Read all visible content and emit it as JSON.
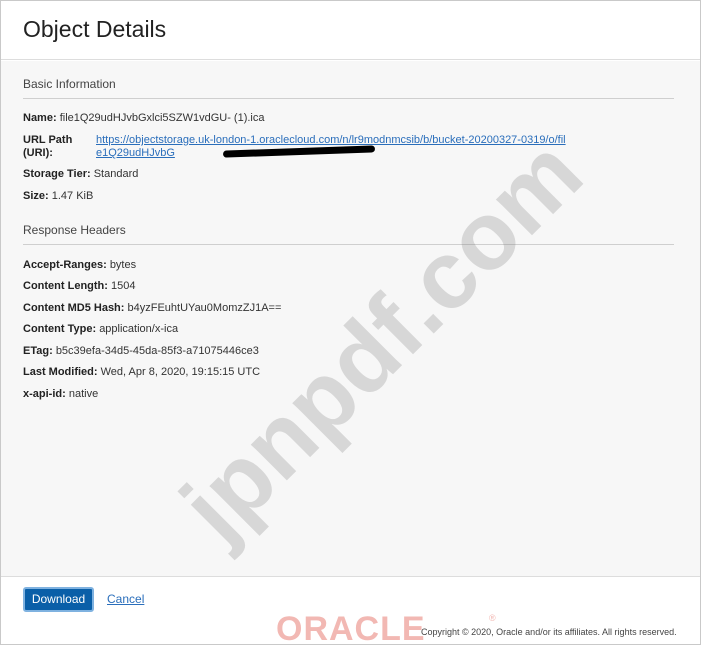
{
  "dialog": {
    "title": "Object Details"
  },
  "basic_info": {
    "heading": "Basic Information",
    "name_label": "Name:",
    "name_value": "file1Q29udHJvbGxlci5SZW1vdGU- (1).ica",
    "url_label": "URL Path (URI):",
    "url_value": "https://objectstorage.uk-london-1.oraclecloud.com/n/lr9modnmcsib/b/bucket-20200327-0319/o/file1Q29udHJvbGxlci5SZW1vdGU-%20(1).ica",
    "url_display": "https://objectstorage.uk-london-1.oraclecloud.com/n/lr9modnmcsib/b/bucket-20200327-0319/o/file1Q29udHJvbG",
    "tier_label": "Storage Tier:",
    "tier_value": "Standard",
    "size_label": "Size:",
    "size_value": "1.47 KiB"
  },
  "response_headers": {
    "heading": "Response Headers",
    "rows": [
      {
        "label": "Accept-Ranges:",
        "value": "bytes"
      },
      {
        "label": "Content Length:",
        "value": "1504"
      },
      {
        "label": "Content MD5 Hash:",
        "value": "b4yzFEuhtUYau0MomzZJ1A=="
      },
      {
        "label": "Content Type:",
        "value": "application/x-ica"
      },
      {
        "label": "ETag:",
        "value": "b5c39efa-34d5-45da-85f3-a71075446ce3"
      },
      {
        "label": "Last Modified:",
        "value": "Wed, Apr 8, 2020, 19:15:15 UTC"
      },
      {
        "label": "x-api-id:",
        "value": "native"
      }
    ]
  },
  "footer": {
    "download_label": "Download",
    "cancel_label": "Cancel",
    "logo_text": "ORACLE",
    "logo_mark": "®",
    "copyright": "Copyright © 2020, Oracle and/or its affiliates. All rights reserved."
  },
  "watermark": "jpnpdf.com",
  "colors": {
    "primary_button": "#0a5fa8",
    "link": "#2a6ebb",
    "oracle_logo": "#f2b8b3"
  }
}
